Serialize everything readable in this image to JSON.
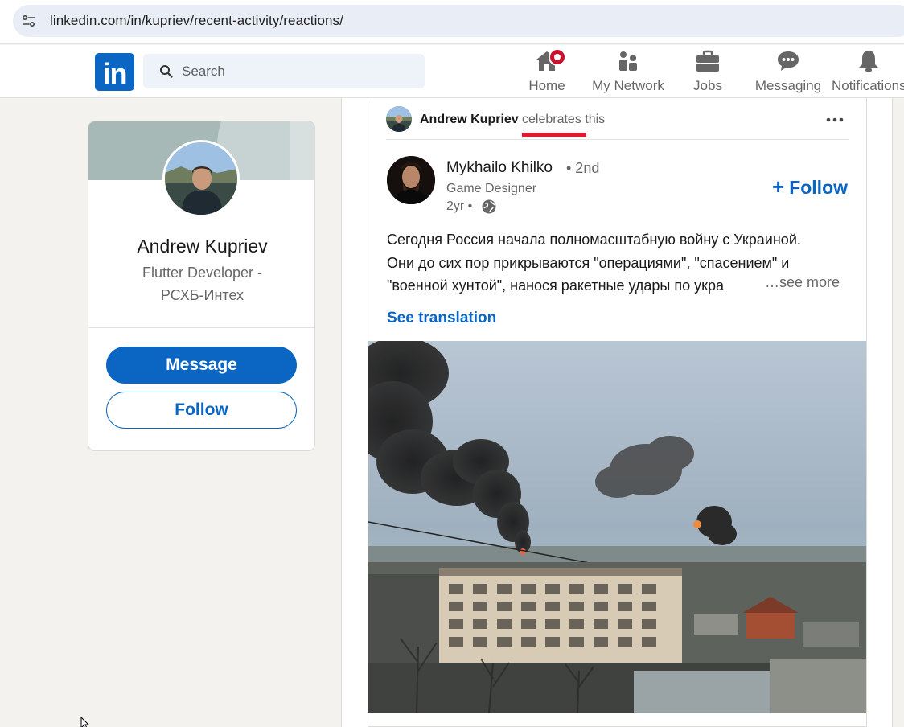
{
  "browser": {
    "url": "linkedin.com/in/kupriev/recent-activity/reactions/"
  },
  "nav": {
    "logo_text": "in",
    "search_placeholder": "Search",
    "items": [
      {
        "label": "Home",
        "icon": "home-icon"
      },
      {
        "label": "My Network",
        "icon": "network-icon"
      },
      {
        "label": "Jobs",
        "icon": "briefcase-icon"
      },
      {
        "label": "Messaging",
        "icon": "messaging-icon"
      },
      {
        "label": "Notifications",
        "icon": "bell-icon"
      }
    ]
  },
  "profile": {
    "name": "Andrew Kupriev",
    "headline": "Flutter Developer - РСХБ-Интех",
    "message_label": "Message",
    "follow_label": "Follow"
  },
  "activity": {
    "actor": "Andrew Kupriev",
    "verb": "celebrates this"
  },
  "post": {
    "author_name": "Mykhailo Khilko",
    "author_degree": "• 2nd",
    "author_title": "Game Designer",
    "time": "2yr •",
    "follow_label": "Follow",
    "text_lines": [
      "Сегодня Россия начала полномасштабную войну с Украиной.",
      "Они до сих пор прикрываются \"операциями\", \"спасением\" и",
      "\"военной хунтой\", нанося ракетные удары по укра"
    ],
    "see_more": "…see more",
    "see_translation": "See translation"
  },
  "colors": {
    "brand": "#0a66c2",
    "badge": "#cb112d",
    "highlight": "#e0192f"
  }
}
